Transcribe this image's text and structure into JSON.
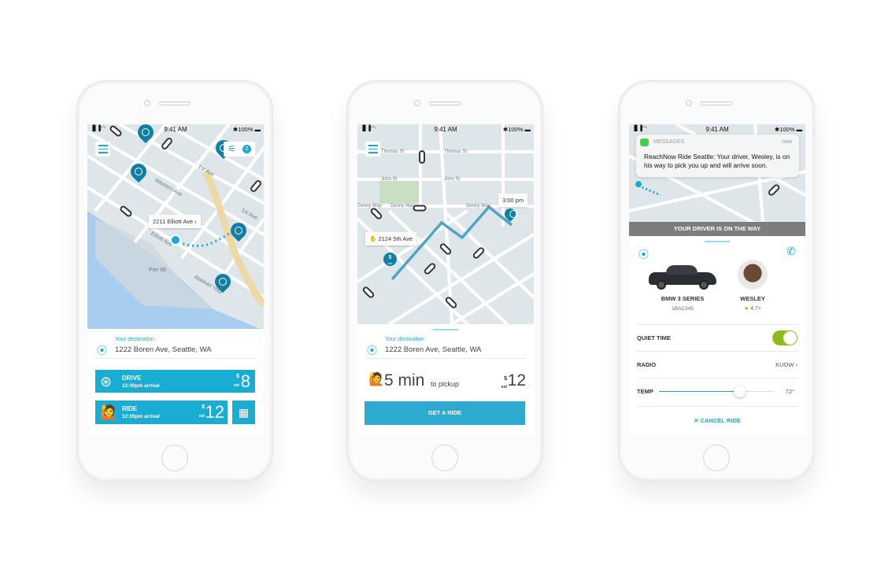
{
  "status_bar": {
    "time": "9:41 AM",
    "battery": "100%",
    "signal": "▐▌▐ ◠"
  },
  "phone1": {
    "filter_count": "2",
    "location_callout": "2211 Elliott Ave",
    "map_labels": [
      "Western Ave",
      "1st Ave",
      "Elliott Ave",
      "Pier 66",
      "Alaskan Way",
      "1st Ave"
    ],
    "destination_label": "Your destination",
    "destination": "1222 Boren Ave, Seattle, WA",
    "options": [
      {
        "name": "DRIVE",
        "arrival": "12:30pm arrival",
        "currency": "$",
        "est": "est",
        "price": "8",
        "icon": "steering-wheel-icon"
      },
      {
        "name": "RIDE",
        "arrival": "12:20pm arrival",
        "currency": "$",
        "est": "est",
        "price": "12",
        "icon": "person-hailing-icon"
      }
    ],
    "schedule_icon": "calendar-clock-icon"
  },
  "phone2": {
    "eta_callout": "3:00 pm",
    "pickup_callout": "2124 5th Ave",
    "pickup_pin_number": "5",
    "pickup_pin_unit": "min",
    "map_labels": [
      "Thomas St",
      "Thomas St",
      "John St",
      "John St",
      "Denny Way",
      "Denny Way",
      "Denny Way"
    ],
    "destination_label": "Your destination",
    "destination": "1222 Boren Ave, Seattle, WA",
    "eta_value": "5 min",
    "eta_suffix": "to pickup",
    "currency": "$",
    "est": "est",
    "price": "12",
    "cta": "GET A RIDE"
  },
  "phone3": {
    "notification": {
      "app": "MESSAGES",
      "time": "now",
      "body": "ReachNow Ride Seattle: Your driver, Wesley, is on his way to pick you up and will arrive soon."
    },
    "banner": "YOUR DRIVER IS ON THE WAY",
    "car_model": "BMW 3 SERIES",
    "plate": "1BAC345",
    "driver_name": "WESLEY",
    "rating": "4.7+",
    "quiet_time_label": "QUIET TIME",
    "quiet_time_on": true,
    "radio_label": "RADIO",
    "radio_value": "KUOW",
    "temp_label": "TEMP",
    "temp_value": "72°",
    "temp_slider_fraction": 0.7,
    "cancel": "CANCEL RIDE"
  },
  "colors": {
    "accent": "#1aadd3",
    "pin": "#0f7fa6",
    "toggle": "#8cbc1c",
    "banner": "#7d7d7d",
    "map": "#dfe6ea",
    "water": "#a9cdef"
  }
}
